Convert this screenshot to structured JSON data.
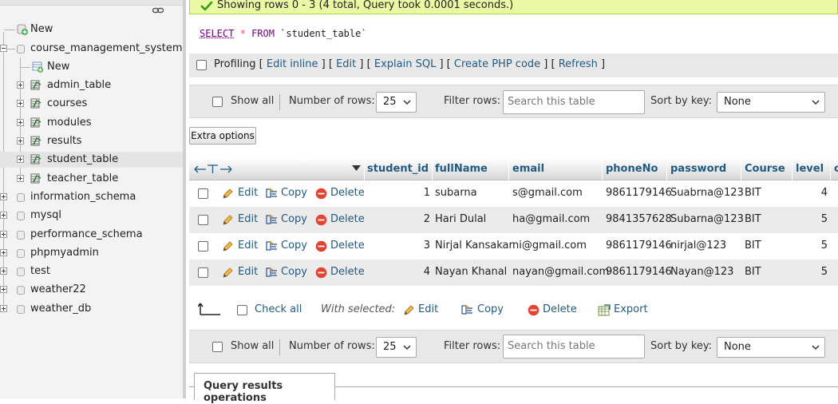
{
  "nav": {
    "items": [
      {
        "label": "New"
      },
      {
        "label": "course_management_system"
      },
      {
        "label": "New"
      },
      {
        "label": "admin_table"
      },
      {
        "label": "courses"
      },
      {
        "label": "modules"
      },
      {
        "label": "results"
      },
      {
        "label": "student_table"
      },
      {
        "label": "teacher_table"
      },
      {
        "label": "information_schema"
      },
      {
        "label": "mysql"
      },
      {
        "label": "performance_schema"
      },
      {
        "label": "phpmyadmin"
      },
      {
        "label": "test"
      },
      {
        "label": "weather22"
      },
      {
        "label": "weather_db"
      }
    ]
  },
  "success": {
    "text": "Showing rows 0 - 3 (4 total, Query took 0.0001 seconds.)"
  },
  "sql": {
    "select": "SELECT",
    "star": "*",
    "from": "FROM",
    "table": "`student_table`"
  },
  "profiling": {
    "label": "Profiling",
    "links": [
      "Edit inline",
      "Edit",
      "Explain SQL",
      "Create PHP code",
      "Refresh"
    ],
    "open": "[",
    "close": "]"
  },
  "navbar": {
    "show_all": "Show all",
    "number_of_rows": "Number of rows:",
    "rows_value": "25",
    "filter_rows": "Filter rows:",
    "search_placeholder": "Search this table",
    "sort_by_key": "Sort by key:",
    "sort_value": "None"
  },
  "extra_options": "Extra options",
  "table": {
    "columns": [
      "student_id",
      "fullName",
      "email",
      "phoneNo",
      "password",
      "Course",
      "level",
      "c"
    ],
    "actions": {
      "edit": "Edit",
      "copy": "Copy",
      "delete": "Delete"
    },
    "rows": [
      {
        "student_id": "1",
        "fullName": "subarna",
        "email": "s@gmail.com",
        "phoneNo": "9861179146",
        "password": "Suabrna@123",
        "Course": "BIT",
        "level": "4"
      },
      {
        "student_id": "2",
        "fullName": "Hari Dulal",
        "email": "ha@gmail.com",
        "phoneNo": "9841357628",
        "password": "Subarna@123",
        "Course": "BIT",
        "level": "5"
      },
      {
        "student_id": "3",
        "fullName": "Nirjal Kansakar",
        "email": "ni@gmail.com",
        "phoneNo": "9861179146",
        "password": "nirjal@123",
        "Course": "BIT",
        "level": "5"
      },
      {
        "student_id": "4",
        "fullName": "Nayan Khanal",
        "email": "nayan@gmail.com",
        "phoneNo": "9861179146",
        "password": "Nayan@123",
        "Course": "BIT",
        "level": "5"
      }
    ]
  },
  "bulk": {
    "check_all": "Check all",
    "with_selected": "With selected:",
    "edit": "Edit",
    "copy": "Copy",
    "delete": "Delete",
    "export": "Export"
  },
  "results_ops": "Query results operations",
  "colors": {
    "link": "#235a81",
    "success_bg": "#ebf8a4",
    "delete_red": "#e04433"
  }
}
